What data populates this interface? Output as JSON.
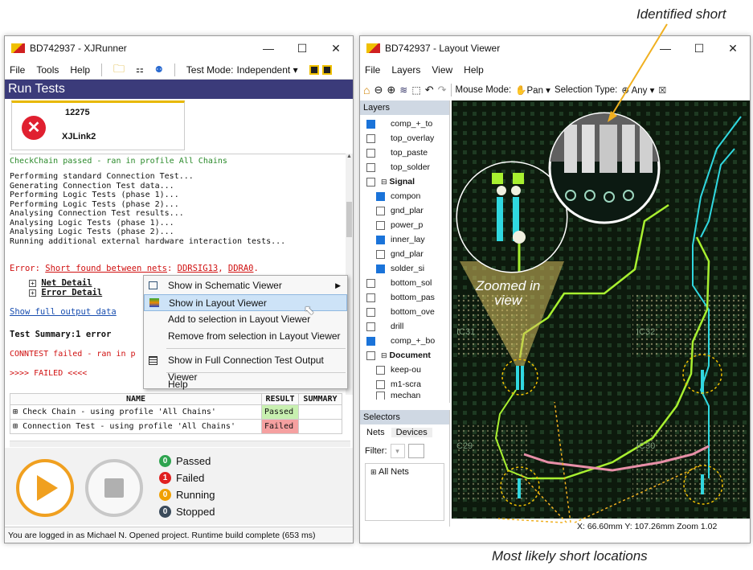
{
  "callouts": {
    "identified_short": "Identified short",
    "most_likely": "Most likely short locations"
  },
  "xjrunner": {
    "title": "BD742937 - XJRunner",
    "menu": [
      "File",
      "Tools",
      "Help"
    ],
    "test_mode_label": "Test Mode:",
    "test_mode_value": "Independent",
    "panel_title": "Run Tests",
    "device_id": "12275",
    "device_name": "XJLink2",
    "log": {
      "checkchain": "CheckChain passed - ran in profile All Chains",
      "lines": [
        "Performing standard Connection Test...",
        "Generating Connection Test data...",
        "Performing Logic Tests (phase 1)...",
        "Performing Logic Tests (phase 2)...",
        "Analysing Connection Test results...",
        "Analysing Logic Tests (phase 1)...",
        "Analysing Logic Tests (phase 2)...",
        "Running additional external hardware interaction tests..."
      ],
      "error_prefix": "Error: ",
      "error_link": "Short found between nets",
      "error_colon": ": ",
      "net1": "DDRSIG13",
      "comma": ", ",
      "net2": "DDRA0",
      "period": ".",
      "net_detail": "Net Detail",
      "error_detail": "Error Detail",
      "show_full": "Show full output data",
      "summary": "Test Summary:1 error",
      "conntest": "CONNTEST failed - ran in p",
      "failed": ">>>> FAILED <<<<"
    },
    "context_menu": [
      "Show in Schematic Viewer",
      "Show in Layout Viewer",
      "Add to selection in Layout Viewer",
      "Remove from selection in Layout Viewer",
      "Show in Full Connection Test Output Viewer",
      "Help"
    ],
    "table": {
      "headers": [
        "NAME",
        "RESULT",
        "SUMMARY"
      ],
      "rows": [
        {
          "name": "Check Chain - using profile 'All Chains'",
          "result": "Passed"
        },
        {
          "name": "Connection Test - using profile 'All Chains'",
          "result": "Failed"
        }
      ]
    },
    "legend": [
      {
        "count": "0",
        "label": "Passed",
        "color": "#2ea44f"
      },
      {
        "count": "1",
        "label": "Failed",
        "color": "#e02020"
      },
      {
        "count": "0",
        "label": "Running",
        "color": "#f0a000"
      },
      {
        "count": "0",
        "label": "Stopped",
        "color": "#3a4a5a"
      }
    ],
    "status": "You are logged in as Michael N.  Opened project.  Runtime build complete (653 ms)"
  },
  "layout": {
    "title": "BD742937 - Layout Viewer",
    "menu": [
      "File",
      "Layers",
      "View",
      "Help"
    ],
    "mouse_mode_label": "Mouse Mode:",
    "mouse_mode_value": "Pan",
    "selection_type_label": "Selection Type:",
    "selection_type_value": "Any",
    "layers_title": "Layers",
    "layers": [
      {
        "label": "comp_+_to",
        "checked": true,
        "indent": 0
      },
      {
        "label": "top_overlay",
        "checked": false,
        "indent": 0
      },
      {
        "label": "top_paste",
        "checked": false,
        "indent": 0
      },
      {
        "label": "top_solder",
        "checked": false,
        "indent": 0
      },
      {
        "label": "Signal",
        "checked": false,
        "indent": 0,
        "group": true
      },
      {
        "label": "compon",
        "checked": true,
        "indent": 1
      },
      {
        "label": "gnd_plar",
        "checked": false,
        "indent": 1
      },
      {
        "label": "power_p",
        "checked": false,
        "indent": 1
      },
      {
        "label": "inner_lay",
        "checked": true,
        "indent": 1
      },
      {
        "label": "gnd_plar",
        "checked": false,
        "indent": 1
      },
      {
        "label": "solder_si",
        "checked": true,
        "indent": 1
      },
      {
        "label": "bottom_sol",
        "checked": false,
        "indent": 0
      },
      {
        "label": "bottom_pas",
        "checked": false,
        "indent": 0
      },
      {
        "label": "bottom_ove",
        "checked": false,
        "indent": 0
      },
      {
        "label": "drill",
        "checked": false,
        "indent": 0
      },
      {
        "label": "comp_+_bo",
        "checked": true,
        "indent": 0
      },
      {
        "label": "Document",
        "checked": false,
        "indent": 0,
        "group": true
      },
      {
        "label": "keep-ou",
        "checked": false,
        "indent": 1
      },
      {
        "label": "m1-scra",
        "checked": false,
        "indent": 1
      },
      {
        "label": "mechan",
        "checked": false,
        "indent": 1
      }
    ],
    "selectors_title": "Selectors",
    "selector_tabs": [
      "Nets",
      "Devices"
    ],
    "filter_label": "Filter:",
    "all_nets": "All Nets",
    "zoomed_label_1": "Zoomed in",
    "zoomed_label_2": "view",
    "board_labels": [
      "IC31",
      "IC32",
      "C29",
      "IC30"
    ],
    "status": "X: 66.60mm  Y: 107.26mm  Zoom 1.02"
  }
}
